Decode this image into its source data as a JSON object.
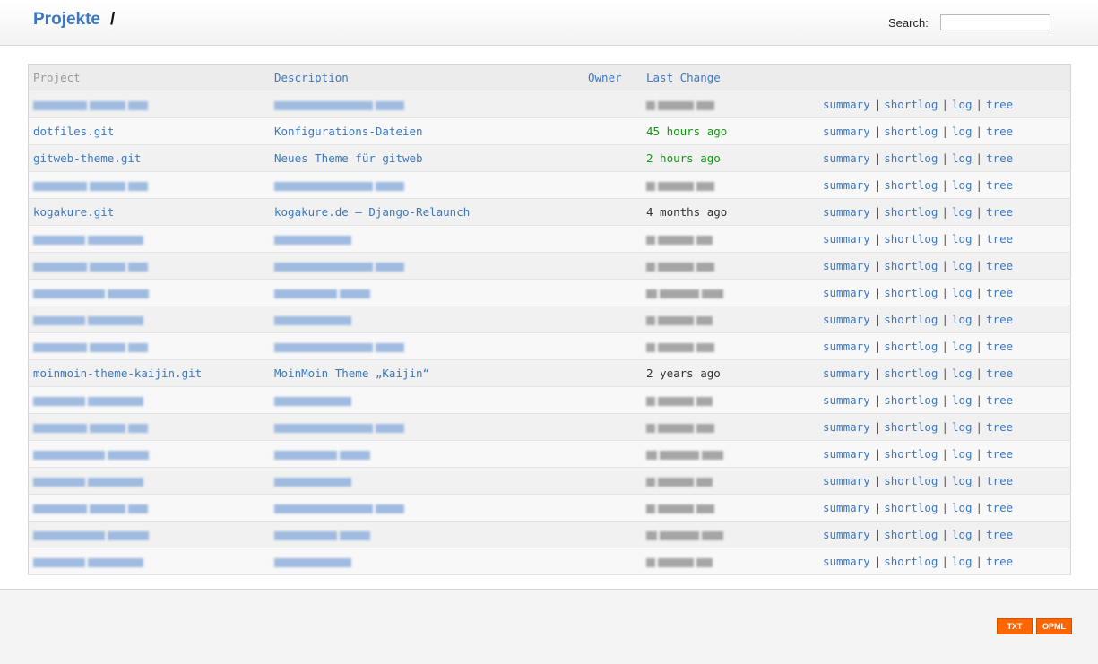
{
  "header": {
    "brand": "Projekte",
    "separator": "/",
    "search_label": "Search:",
    "search_value": ""
  },
  "table": {
    "headers": {
      "project": "Project",
      "description": "Description",
      "owner": "Owner",
      "last_change": "Last Change"
    },
    "actions": [
      "summary",
      "shortlog",
      "log",
      "tree"
    ],
    "rows": [
      {
        "redacted": true
      },
      {
        "project": "dotfiles.git",
        "description": "Konfigurations-Dateien",
        "age": "45 hours ago",
        "recent": true
      },
      {
        "project": "gitweb-theme.git",
        "description": "Neues Theme für gitweb",
        "age": "2 hours ago",
        "recent": true
      },
      {
        "redacted": true
      },
      {
        "project": "kogakure.git",
        "description": "kogakure.de – Django-Relaunch",
        "age": "4 months ago",
        "recent": false
      },
      {
        "redacted": true
      },
      {
        "redacted": true
      },
      {
        "redacted": true
      },
      {
        "redacted": true
      },
      {
        "redacted": true
      },
      {
        "project": "moinmoin-theme-kaijin.git",
        "description": "MoinMoin Theme „Kaijin“",
        "age": "2 years ago",
        "recent": false
      },
      {
        "redacted": true
      },
      {
        "redacted": true
      },
      {
        "redacted": true
      },
      {
        "redacted": true
      },
      {
        "redacted": true
      },
      {
        "redacted": true
      },
      {
        "redacted": true
      }
    ]
  },
  "footer": {
    "txt_label": "TXT",
    "opml_label": "OPML"
  },
  "colors": {
    "link": "#3c78c0",
    "recent": "#119911",
    "feed": "#ff6600"
  }
}
